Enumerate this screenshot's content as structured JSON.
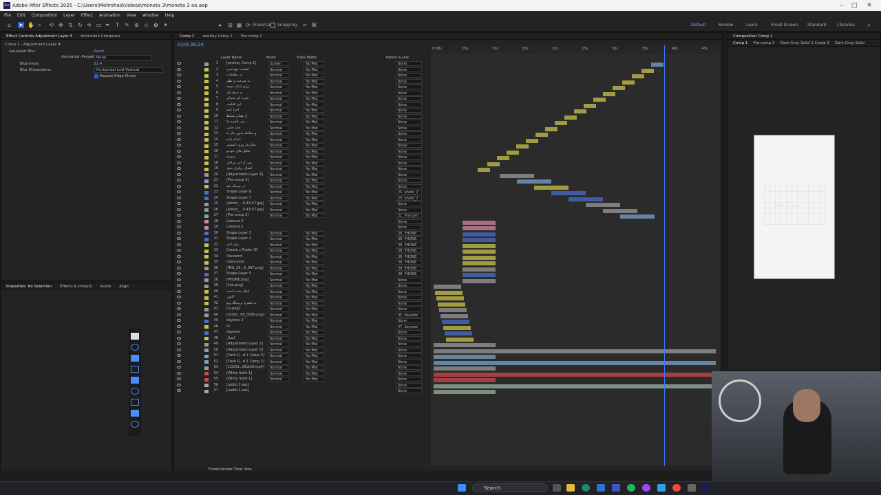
{
  "window": {
    "title": "Adobe After Effects 2025 - C:\\Users\\Mehrshad\\Videos\\moneta 3\\moneta 3 ae.aep"
  },
  "menu": [
    "File",
    "Edit",
    "Composition",
    "Layer",
    "Effect",
    "Animation",
    "View",
    "Window",
    "Help"
  ],
  "toolbar": {
    "universal": "Universal",
    "snapping": "Snapping",
    "workspaces": [
      "Default",
      "Review",
      "Learn",
      "Small Screen",
      "Standard",
      "Libraries"
    ]
  },
  "effect_controls": {
    "tabs": [
      "Effect Controls Adjustment Layer 4",
      "Animation Composer"
    ],
    "crumb": "Comp 1 - Adjustment Layer 4",
    "effect": "Gaussian Blur",
    "reset": "Reset",
    "preset_label": "Animation Presets:",
    "preset_value": "None",
    "blurriness_label": "Blurriness",
    "blurriness_value": "32.4",
    "dimensions_label": "Blur Dimensions",
    "dimensions_value": "Horizontal and Vertical",
    "repeat_label": "Repeat Edge Pixels"
  },
  "properties": {
    "tabs": [
      "Properties: No Selection",
      "Effects & Presets",
      "Audio",
      "Align"
    ]
  },
  "timeline": {
    "tabs": [
      "Comp 1",
      "overlay Comp 1",
      "Pre-comp 2"
    ],
    "timecode": "0;00;38;24",
    "headers": {
      "layer_name": "Layer Name",
      "mode": "Mode",
      "track_matte": "Track Matte",
      "parent": "Parent & Link"
    },
    "ticks": [
      "0:00s",
      "05s",
      "10s",
      "15s",
      "20s",
      "25s",
      "30s",
      "35s",
      "40s",
      "45s"
    ],
    "footer": "Frame Render Time: 9ms",
    "layers": [
      {
        "n": "1",
        "name": "[overlay Comp 1]",
        "mode": "Screen",
        "matte": "No Mat",
        "parent": "None",
        "color": "#7aa3c9"
      },
      {
        "n": "2",
        "name": "اهمیت مهندسی",
        "mode": "Normal",
        "matte": "No Mat",
        "parent": "None",
        "color": "#c9c34a"
      },
      {
        "n": "3",
        "name": "در معاملات",
        "mode": "Normal",
        "matte": "No Mat",
        "parent": "None",
        "color": "#c9c34a"
      },
      {
        "n": "4",
        "name": "به سرعت و نظم",
        "mode": "Normal",
        "matte": "No Mat",
        "parent": "None",
        "color": "#c9c34a"
      },
      {
        "n": "5",
        "name": "برای اینکه بتونید",
        "mode": "Normal",
        "matte": "No Mat",
        "parent": "None",
        "color": "#c9c34a"
      },
      {
        "n": "6",
        "name": "به حرفه ای",
        "mode": "Normal",
        "matte": "No Mat",
        "parent": "None",
        "color": "#c9c34a"
      },
      {
        "n": "7",
        "name": "تجربه ای متمایز",
        "mode": "Normal",
        "matte": "No Mat",
        "parent": "None",
        "color": "#c9c34a"
      },
      {
        "n": "8",
        "name": "این قابلیت",
        "mode": "Normal",
        "matte": "No Mat",
        "parent": "None",
        "color": "#c9c34a"
      },
      {
        "n": "9",
        "name": "اجرا کنید",
        "mode": "Normal",
        "matte": "No Mat",
        "parent": "None",
        "color": "#c9c34a"
      },
      {
        "n": "10",
        "name": "از همان محیط",
        "mode": "Normal",
        "matte": "No Mat",
        "parent": "None",
        "color": "#c9c34a"
      },
      {
        "n": "11",
        "name": "بین پلتفرم ها",
        "mode": "Normal",
        "matte": "No Mat",
        "parent": "None",
        "color": "#c9c34a"
      },
      {
        "n": "12",
        "name": "جابه جایی",
        "mode": "Normal",
        "matte": "No Mat",
        "parent": "None",
        "color": "#c9c34a"
      },
      {
        "n": "13",
        "name": "و معامله بدون نیاز به",
        "mode": "Normal",
        "matte": "No Mat",
        "parent": "None",
        "color": "#c9c34a"
      },
      {
        "n": "14",
        "name": "انجام داده",
        "mode": "Normal",
        "matte": "No Mat",
        "parent": "None",
        "color": "#c9c34a"
      },
      {
        "n": "15",
        "name": "متاتریدر ورود آسونتر",
        "mode": "Normal",
        "matte": "No Mat",
        "parent": "None",
        "color": "#c9c34a"
      },
      {
        "n": "16",
        "name": "تحلیل های خودتو",
        "mode": "Normal",
        "matte": "No Mat",
        "parent": "None",
        "color": "#c9c34a"
      },
      {
        "n": "17",
        "name": "میتونید",
        "mode": "Normal",
        "matte": "No Mat",
        "parent": "None",
        "color": "#c9c34a"
      },
      {
        "n": "18",
        "name": "پس از این مراحل",
        "mode": "Normal",
        "matte": "No Mat",
        "parent": "None",
        "color": "#c9c34a"
      },
      {
        "n": "19",
        "name": "اتصال برقرار شود",
        "mode": "Normal",
        "matte": "No Mat",
        "parent": "None",
        "color": "#c9c34a"
      },
      {
        "n": "20",
        "name": "[Adjustment Layer 4]",
        "mode": "Normal",
        "matte": "No Mat",
        "parent": "None",
        "color": "#9a9a9a"
      },
      {
        "n": "21",
        "name": "[Pre-comp 3]",
        "mode": "Normal",
        "matte": "No Mat",
        "parent": "None",
        "color": "#7aa3c9"
      },
      {
        "n": "22",
        "name": "در مرحله بعد",
        "mode": "Normal",
        "matte": "No Mat",
        "parent": "None",
        "color": "#c9c34a"
      },
      {
        "n": "23",
        "name": "Shape Layer 8",
        "mode": "Normal",
        "matte": "No Mat",
        "parent": "25. photo_2",
        "color": "#4a6ec9"
      },
      {
        "n": "24",
        "name": "Shape Layer 7",
        "mode": "Normal",
        "matte": "No Mat",
        "parent": "25. photo_2",
        "color": "#4a6ec9"
      },
      {
        "n": "25",
        "name": "[photo_...9-43-57.jpg]",
        "mode": "Normal",
        "matte": "No Mat",
        "parent": "None",
        "color": "#9a9a9a"
      },
      {
        "n": "26",
        "name": "[photo_...9-43-57.jpg]",
        "mode": "Normal",
        "matte": "No Mat",
        "parent": "None",
        "color": "#9a9a9a"
      },
      {
        "n": "27",
        "name": "[Pre-comp 2]",
        "mode": "Normal",
        "matte": "No Mat",
        "parent": "21. Pre-com",
        "color": "#7aa3c9"
      },
      {
        "n": "28",
        "name": "Camera 3",
        "mode": "",
        "matte": "",
        "parent": "None",
        "color": "#d18aa0"
      },
      {
        "n": "29",
        "name": "Camera 2",
        "mode": "",
        "matte": "",
        "parent": "None",
        "color": "#d18aa0"
      },
      {
        "n": "30",
        "name": "Shape Layer 3",
        "mode": "Normal",
        "matte": "No Mat",
        "parent": "38. PHONE.",
        "color": "#4a6ec9"
      },
      {
        "n": "31",
        "name": "Shape Layer 2",
        "mode": "Normal",
        "matte": "No Mat",
        "parent": "38. PHONE.",
        "color": "#4a6ec9"
      },
      {
        "n": "32",
        "name": "برای آغاز",
        "mode": "Normal",
        "matte": "No Mat",
        "parent": "38. PHONE.",
        "color": "#c9c34a"
      },
      {
        "n": "33",
        "name": "Create c.Trader ID",
        "mode": "Normal",
        "matte": "No Mat",
        "parent": "38. PHONE.",
        "color": "#c9c34a"
      },
      {
        "n": "34",
        "name": "Password",
        "mode": "Normal",
        "matte": "No Mat",
        "parent": "38. PHONE.",
        "color": "#c9c34a"
      },
      {
        "n": "35",
        "name": "Username",
        "mode": "Normal",
        "matte": "No Mat",
        "parent": "38. PHONE.",
        "color": "#c9c34a"
      },
      {
        "n": "36",
        "name": "[IMG_20...5_967.png]",
        "mode": "Normal",
        "matte": "No Mat",
        "parent": "38. PHONE.",
        "color": "#9a9a9a"
      },
      {
        "n": "37",
        "name": "Shape Layer 5",
        "mode": "Normal",
        "matte": "No Mat",
        "parent": "38. PHONE.",
        "color": "#4a6ec9"
      },
      {
        "n": "38",
        "name": "[PHONE.png]",
        "mode": "Normal",
        "matte": "No Mat",
        "parent": "None",
        "color": "#9a9a9a"
      },
      {
        "n": "39",
        "name": "[link.png]",
        "mode": "Normal",
        "matte": "No Mat",
        "parent": "None",
        "color": "#9a9a9a"
      },
      {
        "n": "40",
        "name": "فعال شده است",
        "mode": "Normal",
        "matte": "No Mat",
        "parent": "None",
        "color": "#c9c34a"
      },
      {
        "n": "41",
        "name": "اکنون",
        "mode": "Normal",
        "matte": "No Mat",
        "parent": "None",
        "color": "#c9c34a"
      },
      {
        "n": "42",
        "name": "به پلتفرم تریدینگ ویو",
        "mode": "Normal",
        "matte": "No Mat",
        "parent": "None",
        "color": "#c9c34a"
      },
      {
        "n": "43",
        "name": "[tv.png]",
        "mode": "Normal",
        "matte": "No Mat",
        "parent": "None",
        "color": "#9a9a9a"
      },
      {
        "n": "44",
        "name": "[Untitl...00_0000.png]",
        "mode": "Normal",
        "matte": "No Mat",
        "parent": "45. dayeres",
        "color": "#9a9a9a"
      },
      {
        "n": "45",
        "name": "dayeres 2",
        "mode": "Normal",
        "matte": "No Mat",
        "parent": "None",
        "color": "#4a6ec9"
      },
      {
        "n": "46",
        "name": "tv",
        "mode": "Normal",
        "matte": "No Mat",
        "parent": "47. dayeres",
        "color": "#c9c34a"
      },
      {
        "n": "47",
        "name": "dayeres",
        "mode": "Normal",
        "matte": "No Mat",
        "parent": "None",
        "color": "#4a6ec9"
      },
      {
        "n": "48",
        "name": "اتصال",
        "mode": "Normal",
        "matte": "No Mat",
        "parent": "None",
        "color": "#c9c34a"
      },
      {
        "n": "49",
        "name": "[Adjustment Layer 2]",
        "mode": "Normal",
        "matte": "No Mat",
        "parent": "None",
        "color": "#9a9a9a"
      },
      {
        "n": "50",
        "name": "[Adjustment Layer 3]",
        "mode": "Normal",
        "matte": "No Mat",
        "parent": "None",
        "color": "#9a9a9a"
      },
      {
        "n": "51",
        "name": "[Dark G...d 1 Comp 3]",
        "mode": "Normal",
        "matte": "No Mat",
        "parent": "None",
        "color": "#7aa3c9"
      },
      {
        "n": "52",
        "name": "[Dark G...d 1 Comp 2]",
        "mode": "Normal",
        "matte": "No Mat",
        "parent": "None",
        "color": "#7aa3c9"
      },
      {
        "n": "53",
        "name": "[Cl23fd...0Eale9.mp4]",
        "mode": "Normal",
        "matte": "No Mat",
        "parent": "None",
        "color": "#9a9a9a"
      },
      {
        "n": "54",
        "name": "[White Solid 1]",
        "mode": "Normal",
        "matte": "No Mat",
        "parent": "None",
        "color": "#c94a4a"
      },
      {
        "n": "55",
        "name": "[White Solid 1]",
        "mode": "Normal",
        "matte": "No Mat",
        "parent": "None",
        "color": "#c94a4a"
      },
      {
        "n": "56",
        "name": "[audio 3.aac]",
        "mode": "",
        "matte": "",
        "parent": "None",
        "color": "#9ab0a0"
      },
      {
        "n": "57",
        "name": "[audio 2.aac]",
        "mode": "",
        "matte": "",
        "parent": "None",
        "color": "#9ab0a0"
      }
    ]
  },
  "composition": {
    "tab": "Composition Comp 1",
    "subtabs": [
      "Comp 1",
      "Pre-comp 2",
      "Dark Gray Solid 1 Comp 3",
      "Dark Gray Solid"
    ],
    "preview_text": "تجربه ای متمایز"
  },
  "taskbar": {
    "search": "Search"
  },
  "colors": {
    "accent": "#3b78ff",
    "panel": "#232323",
    "timeline_bg": "#2b2b2b"
  }
}
